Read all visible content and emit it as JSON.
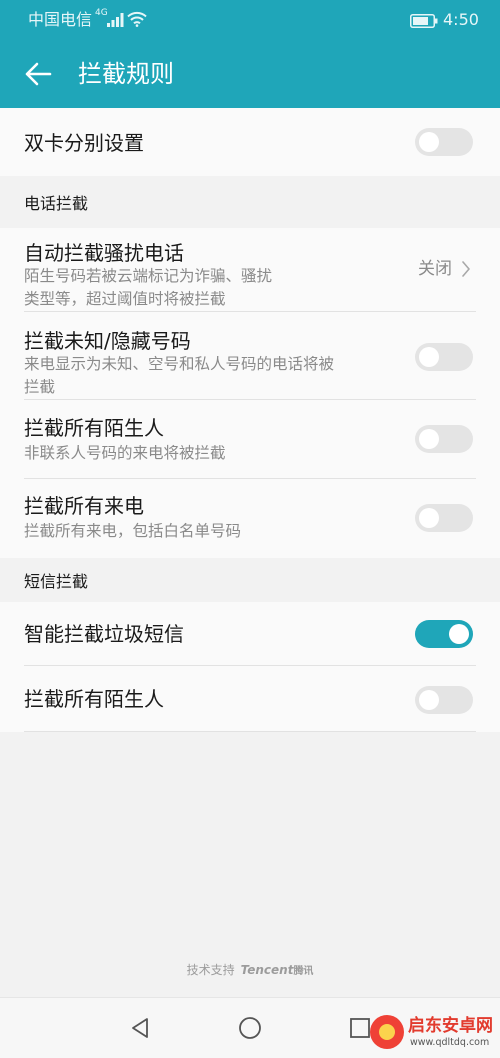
{
  "status_bar": {
    "carrier": "中国电信",
    "network_type": "4G",
    "time": "4:50"
  },
  "header": {
    "title": "拦截规则",
    "background_color": "#1fa6b9"
  },
  "dual_sim": {
    "label": "双卡分别设置",
    "enabled": false
  },
  "call_section": {
    "header": "电话拦截",
    "items": [
      {
        "title": "自动拦截骚扰电话",
        "subtitle": "陌生号码若被云端标记为诈骗、骚扰\n类型等，超过阈值时将被拦截",
        "value": "关闭"
      },
      {
        "title": "拦截未知/隐藏号码",
        "subtitle": "来电显示为未知、空号和私人号码的电话将被\n拦截",
        "enabled": false
      },
      {
        "title": "拦截所有陌生人",
        "subtitle": "非联系人号码的来电将被拦截",
        "enabled": false
      },
      {
        "title": "拦截所有来电",
        "subtitle": "拦截所有来电，包括白名单号码",
        "enabled": false
      }
    ]
  },
  "sms_section": {
    "header": "短信拦截",
    "items": [
      {
        "title": "智能拦截垃圾短信",
        "enabled": true
      },
      {
        "title": "拦截所有陌生人",
        "enabled": false
      }
    ]
  },
  "footer": {
    "credit": "技术支持",
    "brand": "Tencent",
    "brand_cn": "腾讯"
  },
  "watermark": {
    "name": "启东安卓网",
    "url": "www.qdltdq.com"
  },
  "colors": {
    "accent": "#1fa6b9",
    "toggle_off": "#e4e4e4"
  }
}
